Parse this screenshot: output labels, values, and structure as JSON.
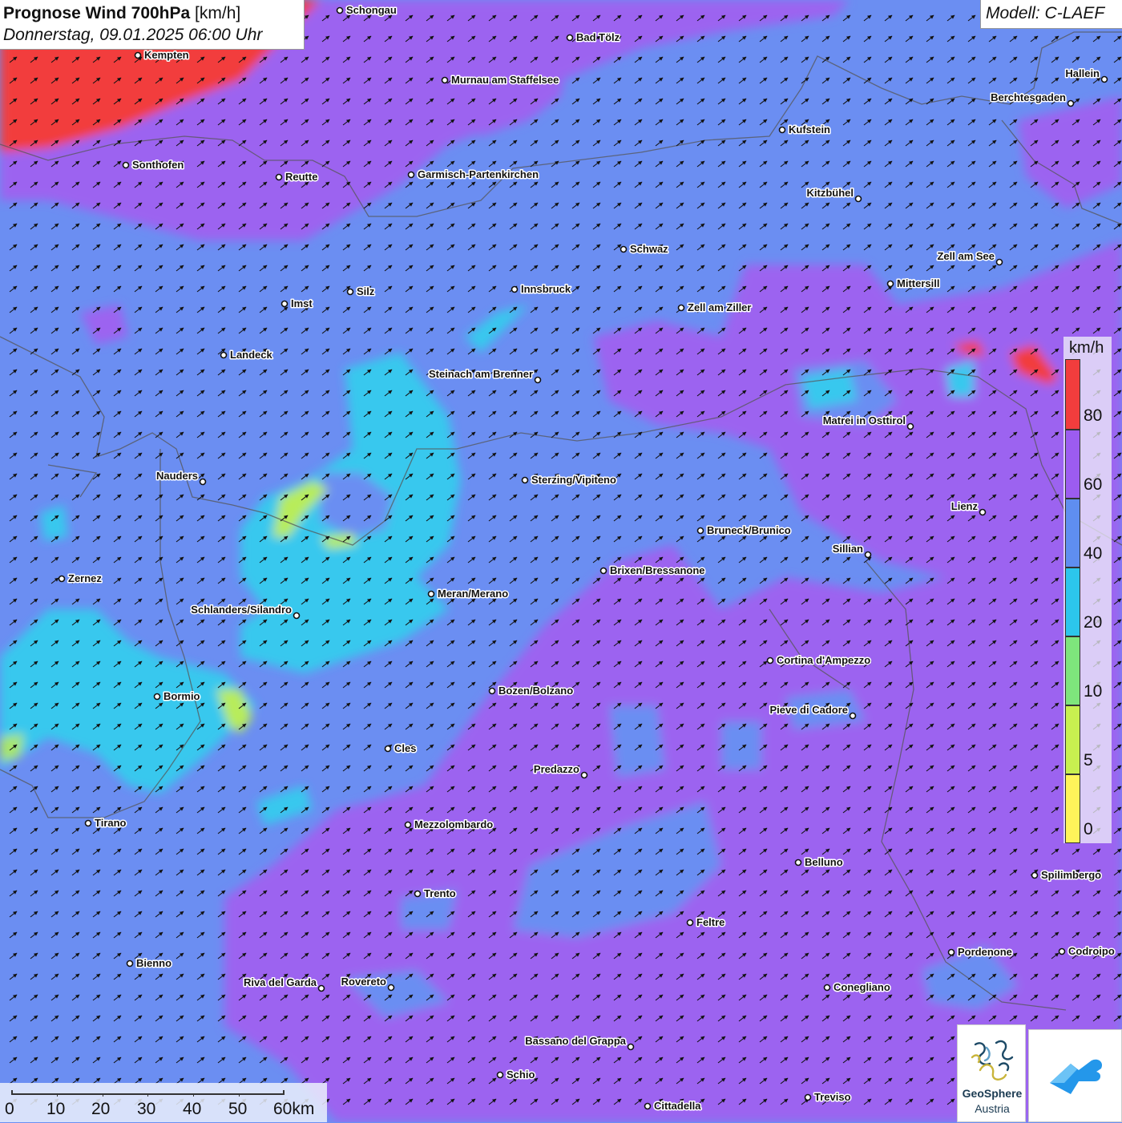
{
  "header": {
    "title_bold": "Prognose Wind 700hPa",
    "title_unit": "[km/h]",
    "datetime": "Donnerstag, 09.01.2025 06:00 Uhr"
  },
  "model": "Modell: C-LAEF",
  "legend": {
    "unit": "km/h",
    "classes": [
      {
        "label": "80",
        "color": "#f23d3d"
      },
      {
        "label": "60",
        "color": "#9c5cf0"
      },
      {
        "label": "40",
        "color": "#5f8ef0"
      },
      {
        "label": "20",
        "color": "#2cc6ec"
      },
      {
        "label": "10",
        "color": "#7ee67c"
      },
      {
        "label": "5",
        "color": "#c8f050"
      },
      {
        "label": "0",
        "color": "#fff45a"
      }
    ],
    "top_color": "#f23d3d"
  },
  "scale_bar": {
    "labels": [
      "0",
      "10",
      "20",
      "30",
      "40",
      "50",
      "60km"
    ]
  },
  "logos": {
    "geosphere_name": "GeoSphere",
    "geosphere_sub": "Austria",
    "geosphere_icon": "geosphere-logo-icon",
    "second_icon": "weather-app-logo-icon"
  },
  "map": {
    "wind_arrow_icon": "wind-arrow-icon",
    "places": [
      {
        "name": "Schongau"
      },
      {
        "name": "Bad Tölz"
      },
      {
        "name": "Kempten"
      },
      {
        "name": "Murnau am Staffelsee"
      },
      {
        "name": "Hallein"
      },
      {
        "name": "Berchtesgaden"
      },
      {
        "name": "Kufstein"
      },
      {
        "name": "Sonthofen"
      },
      {
        "name": "Reutte"
      },
      {
        "name": "Garmisch-Partenkirchen"
      },
      {
        "name": "Kitzbühel"
      },
      {
        "name": "Schwaz"
      },
      {
        "name": "Zell am See"
      },
      {
        "name": "Mittersill"
      },
      {
        "name": "Innsbruck"
      },
      {
        "name": "Silz"
      },
      {
        "name": "Imst"
      },
      {
        "name": "Zell am Ziller"
      },
      {
        "name": "Landeck"
      },
      {
        "name": "Steinach am Brenner"
      },
      {
        "name": "Matrei in Osttirol"
      },
      {
        "name": "Nauders"
      },
      {
        "name": "Sterzing/Vipiteno"
      },
      {
        "name": "Lienz"
      },
      {
        "name": "Bruneck/Brunico"
      },
      {
        "name": "Sillian"
      },
      {
        "name": "Zernez"
      },
      {
        "name": "Brixen/Bressanone"
      },
      {
        "name": "Meran/Merano"
      },
      {
        "name": "Schlanders/Silandro"
      },
      {
        "name": "Cortina d'Ampezzo"
      },
      {
        "name": "Bozen/Bolzano"
      },
      {
        "name": "Bormio"
      },
      {
        "name": "Pieve di Cadore"
      },
      {
        "name": "Cles"
      },
      {
        "name": "Predazzo"
      },
      {
        "name": "Tirano"
      },
      {
        "name": "Mezzolombardo"
      },
      {
        "name": "Belluno"
      },
      {
        "name": "Spilimbergo"
      },
      {
        "name": "Trento"
      },
      {
        "name": "Feltre"
      },
      {
        "name": "Pordenone"
      },
      {
        "name": "Codroipo"
      },
      {
        "name": "Bienno"
      },
      {
        "name": "Riva del Garda"
      },
      {
        "name": "Rovereto"
      },
      {
        "name": "Conegliano"
      },
      {
        "name": "Bassano del Grappa"
      },
      {
        "name": "Schio"
      },
      {
        "name": "Treviso"
      },
      {
        "name": "Cittadella"
      }
    ]
  }
}
